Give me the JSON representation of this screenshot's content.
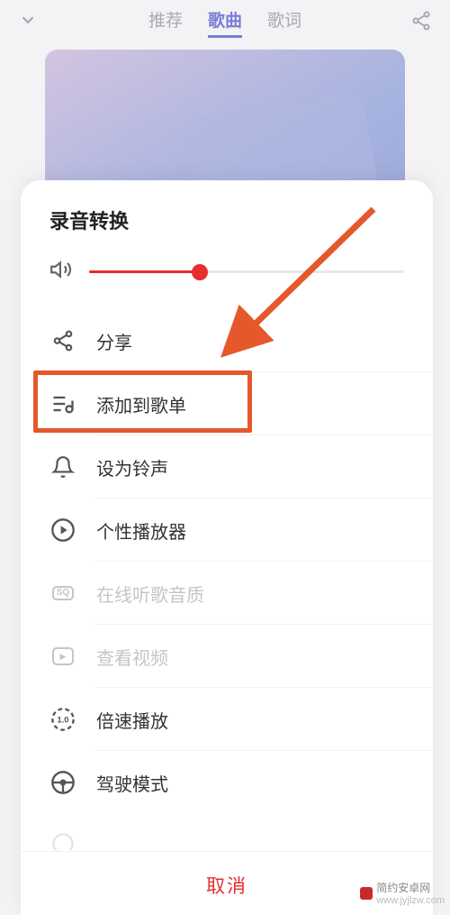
{
  "topTabs": {
    "recommend": "推荐",
    "song": "歌曲",
    "lyrics": "歌词"
  },
  "sheet": {
    "title": "录音转换",
    "cancel": "取消"
  },
  "volume": {
    "percent": 35
  },
  "menu": {
    "share": "分享",
    "addToPlaylist": "添加到歌单",
    "setRingtone": "设为铃声",
    "customPlayer": "个性播放器",
    "onlineQuality": "在线听歌音质",
    "viewVideo": "查看视频",
    "playbackSpeed": "倍速播放",
    "drivingMode": "驾驶模式"
  },
  "watermark": {
    "cn": "简约安卓网",
    "url": "www.jyjlzw.com"
  }
}
